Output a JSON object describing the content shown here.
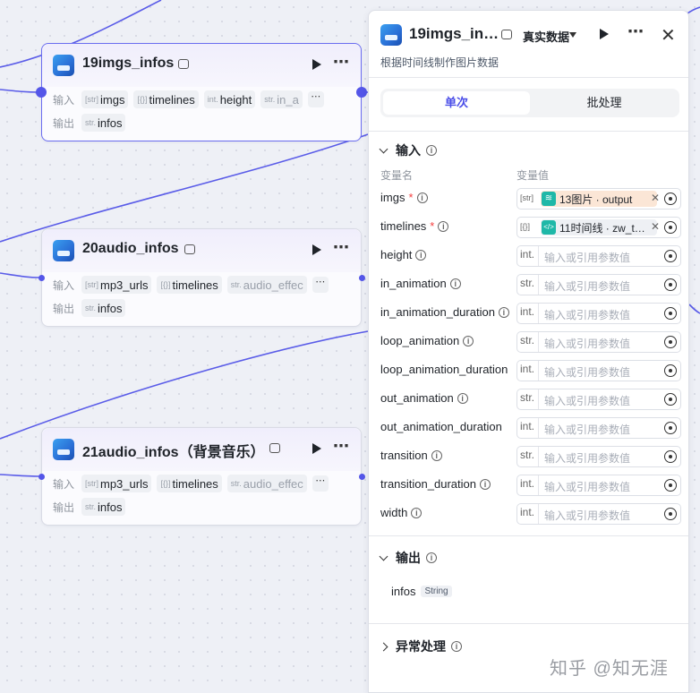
{
  "nodes": [
    {
      "title": "19imgs_infos",
      "input_label": "输入",
      "output_label": "输出",
      "inputs": [
        {
          "type": "[str]",
          "name": "imgs"
        },
        {
          "type": "[{}]",
          "name": "timelines"
        },
        {
          "type": "int.",
          "name": "height"
        },
        {
          "type": "str.",
          "name": "in_a"
        }
      ],
      "outputs": [
        {
          "type": "str.",
          "name": "infos"
        }
      ]
    },
    {
      "title": "20audio_infos",
      "input_label": "输入",
      "output_label": "输出",
      "inputs": [
        {
          "type": "[str]",
          "name": "mp3_urls"
        },
        {
          "type": "[{}]",
          "name": "timelines"
        },
        {
          "type": "str.",
          "name": "audio_effec"
        }
      ],
      "outputs": [
        {
          "type": "str.",
          "name": "infos"
        }
      ]
    },
    {
      "title": "21audio_infos（背景音乐）",
      "input_label": "输入",
      "output_label": "输出",
      "inputs": [
        {
          "type": "[str]",
          "name": "mp3_urls"
        },
        {
          "type": "[{}]",
          "name": "timelines"
        },
        {
          "type": "str.",
          "name": "audio_effec"
        }
      ],
      "outputs": [
        {
          "type": "str.",
          "name": "infos"
        }
      ]
    }
  ],
  "more_glyph": "⋯",
  "panel": {
    "title": "19imgs_in…",
    "mode": "真实数据",
    "description": "根据时间线制作图片数据",
    "tabs": [
      "单次",
      "批处理"
    ],
    "input_section": "输入",
    "col_name": "变量名",
    "col_value": "变量值",
    "placeholder": "输入或引用参数值",
    "params": [
      {
        "name": "imgs",
        "required": true,
        "type": "[str]",
        "ref": "13图片 · output",
        "ref_icon": "≋",
        "ref_style": "a"
      },
      {
        "name": "timelines",
        "required": true,
        "type": "[{}]",
        "ref": "11时间线 · zw_t…",
        "ref_icon": "</>",
        "ref_style": "b"
      },
      {
        "name": "height",
        "required": false,
        "type": "int."
      },
      {
        "name": "in_animation",
        "required": false,
        "type": "str."
      },
      {
        "name": "in_animation_duration",
        "required": false,
        "type": "int."
      },
      {
        "name": "loop_animation",
        "required": false,
        "type": "str."
      },
      {
        "name": "loop_animation_duration",
        "required": false,
        "type": "int."
      },
      {
        "name": "out_animation",
        "required": false,
        "type": "str."
      },
      {
        "name": "out_animation_duration",
        "required": false,
        "type": "int."
      },
      {
        "name": "transition",
        "required": false,
        "type": "str."
      },
      {
        "name": "transition_duration",
        "required": false,
        "type": "int."
      },
      {
        "name": "width",
        "required": false,
        "type": "int."
      }
    ],
    "output_section": "输出",
    "outputs": [
      {
        "name": "infos",
        "type": "String"
      }
    ],
    "error_section": "异常处理"
  },
  "watermark": "知乎 @知无涯",
  "colors": {
    "accent": "#5456e8",
    "required": "#f53f3f",
    "wire": "#5456e8"
  }
}
